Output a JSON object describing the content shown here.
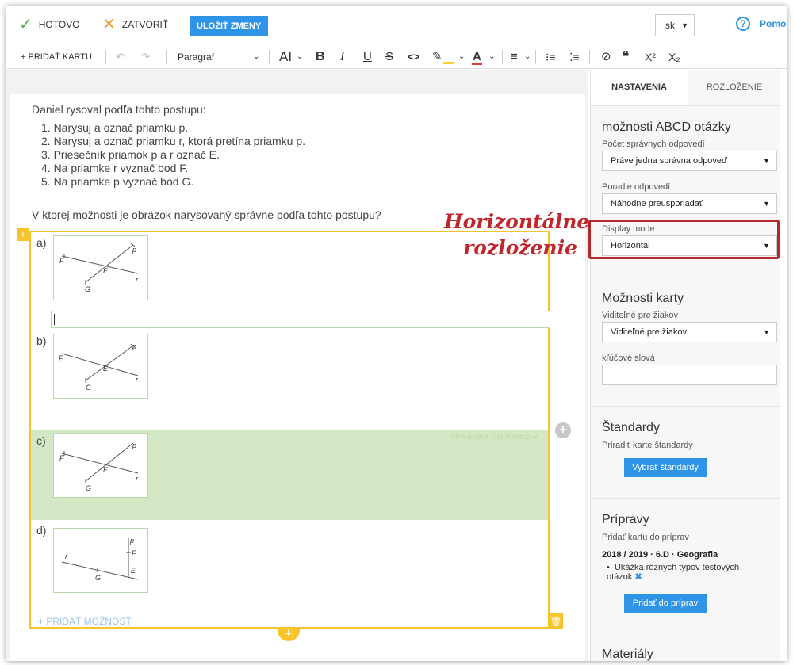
{
  "topbar": {
    "done_label": "HOTOVO",
    "close_label": "ZATVORIŤ",
    "save_label": "ULOŽIŤ ZMENY",
    "language": "sk",
    "help_label": "Pomo"
  },
  "toolbar": {
    "add_card": "+ PRIDAŤ KARTU",
    "paragraph": "Paragraf",
    "font_size_icon": "AI",
    "bold": "B",
    "italic": "I",
    "underline": "U",
    "strike": "S",
    "code": "<>",
    "font_color": "A",
    "superscript": "X²",
    "subscript": "X₂",
    "quote": "❝"
  },
  "question": {
    "intro": "Daniel rysoval podľa tohto postupu:",
    "steps": [
      "1. Narysuj a označ priamku p.",
      "2. Narysuj a označ priamku r, ktorá pretína priamku p.",
      "3. Priesečník priamok p a r označ E.",
      "4. Na priamke r vyznač bod F.",
      "5. Na priamke p vyznač bod G."
    ],
    "prompt": "V ktorej možnosti je obrázok narysovaný správne podľa tohto postupu?"
  },
  "options": [
    {
      "letter": "a)"
    },
    {
      "letter": "b)"
    },
    {
      "letter": "c)",
      "correct_label": "SPRÁVNA ODPOVEĎ"
    },
    {
      "letter": "d)"
    }
  ],
  "figure_labels": {
    "p": "p",
    "r": "r",
    "E": "E",
    "F": "F",
    "G": "G"
  },
  "add_option_label": "PRIDAŤ MOŽNOSŤ",
  "panel": {
    "tab_settings": "NASTAVENIA",
    "tab_layout": "ROZLOŽENIE",
    "abcd": {
      "title": "možnosti ABCD otázky",
      "correct_count_label": "Počet správnych odpovedí",
      "correct_count_value": "Práve jedna správna odpoveď",
      "order_label": "Poradie odpovedí",
      "order_value": "Náhodne preusporiadať",
      "display_label": "Display mode",
      "display_value": "Horizontal"
    },
    "card": {
      "title": "Možnosti karty",
      "visible_label": "Viditeľné pre žiakov",
      "visible_value": "Viditeľné pre žiakov",
      "keywords_label": "kľúčové slová",
      "keywords_value": ""
    },
    "standards": {
      "title": "Štandardy",
      "subtitle": "Priradiť karte štandardy",
      "button": "Vybrať štandardy"
    },
    "prep": {
      "title": "Prípravy",
      "subtitle": "Pridať kartu do príprav",
      "course": "2018 / 2019 · 6.D · Geografia",
      "item": "Ukážka rôznych typov testových otázok",
      "button": "Pridať do príprav"
    },
    "materials_title": "Materiály"
  },
  "annotation": {
    "line1": "Horizontálne",
    "line2": "rozloženie"
  },
  "colors": {
    "accent": "#2e94e8",
    "selection": "#f7c42c",
    "correct_bg": "#d5e8c5",
    "annotation": "#c0262c"
  }
}
